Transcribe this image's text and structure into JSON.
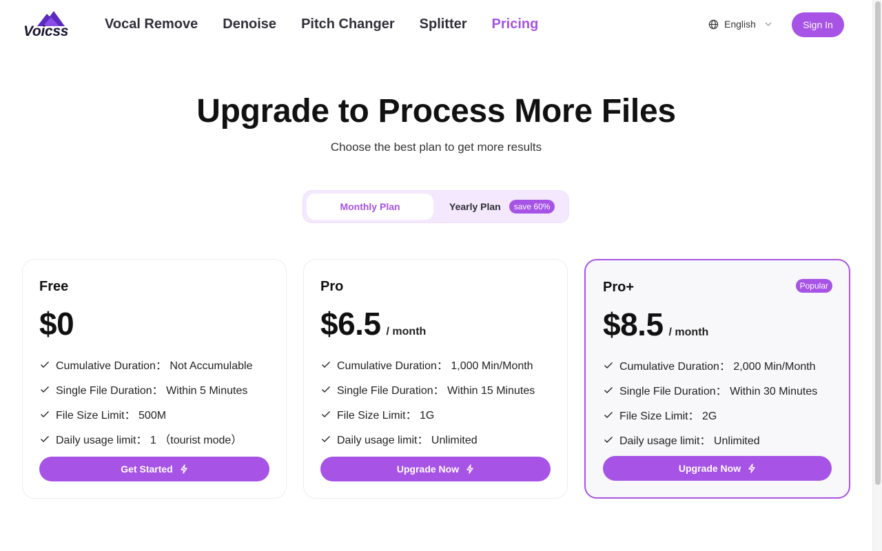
{
  "header": {
    "logo_text": "Voicss",
    "nav": [
      {
        "label": "Vocal Remove"
      },
      {
        "label": "Denoise"
      },
      {
        "label": "Pitch Changer"
      },
      {
        "label": "Splitter"
      },
      {
        "label": "Pricing",
        "active": true
      }
    ],
    "language": "English",
    "sign_in": "Sign In"
  },
  "hero": {
    "title": "Upgrade to Process More Files",
    "subtitle": "Choose the best plan to get more results"
  },
  "toggle": {
    "monthly": "Monthly Plan",
    "yearly": "Yearly Plan",
    "save_badge": "save 60%",
    "selected": "Monthly Plan"
  },
  "plans": [
    {
      "name": "Free",
      "price": "$0",
      "period": "",
      "features": [
        "Cumulative Duration： Not Accumulable",
        "Single File Duration： Within 5 Minutes",
        "File Size Limit： 500M",
        "Daily usage limit： 1 （tourist mode）"
      ],
      "cta": "Get Started"
    },
    {
      "name": "Pro",
      "price": "$6.5",
      "period": "/ month",
      "features": [
        "Cumulative Duration： 1,000 Min/Month",
        "Single File Duration： Within 15 Minutes",
        "File Size Limit： 1G",
        "Daily usage limit： Unlimited"
      ],
      "cta": "Upgrade Now"
    },
    {
      "name": "Pro+",
      "price": "$8.5",
      "period": "/ month",
      "badge": "Popular",
      "features": [
        "Cumulative Duration： 2,000 Min/Month",
        "Single File Duration： Within 30 Minutes",
        "File Size Limit： 2G",
        "Daily usage limit： Unlimited"
      ],
      "cta": "Upgrade Now"
    }
  ],
  "colors": {
    "accent": "#a653e6",
    "toggle_bg": "#f3e8fd",
    "text": "#111111"
  }
}
